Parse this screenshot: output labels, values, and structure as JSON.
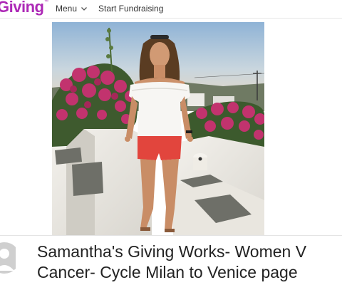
{
  "header": {
    "logo_text": "Giving",
    "logo_tm": "™",
    "menu_label": "Menu",
    "start_fundraising_label": "Start Fundraising"
  },
  "hero": {
    "alt": "Woman in white off-shoulder top and red shorts standing on a whitewashed terrace with bougainvillea at sunset"
  },
  "page": {
    "title_line1": "Samantha's Giving Works- Women V",
    "title_line2": "Cancer- Cycle Milan to Venice page"
  },
  "colors": {
    "brand": "#ad29b6",
    "text": "#222222"
  },
  "icons": {
    "menu_chevron": "chevron-down-icon",
    "avatar": "user-avatar-icon"
  }
}
